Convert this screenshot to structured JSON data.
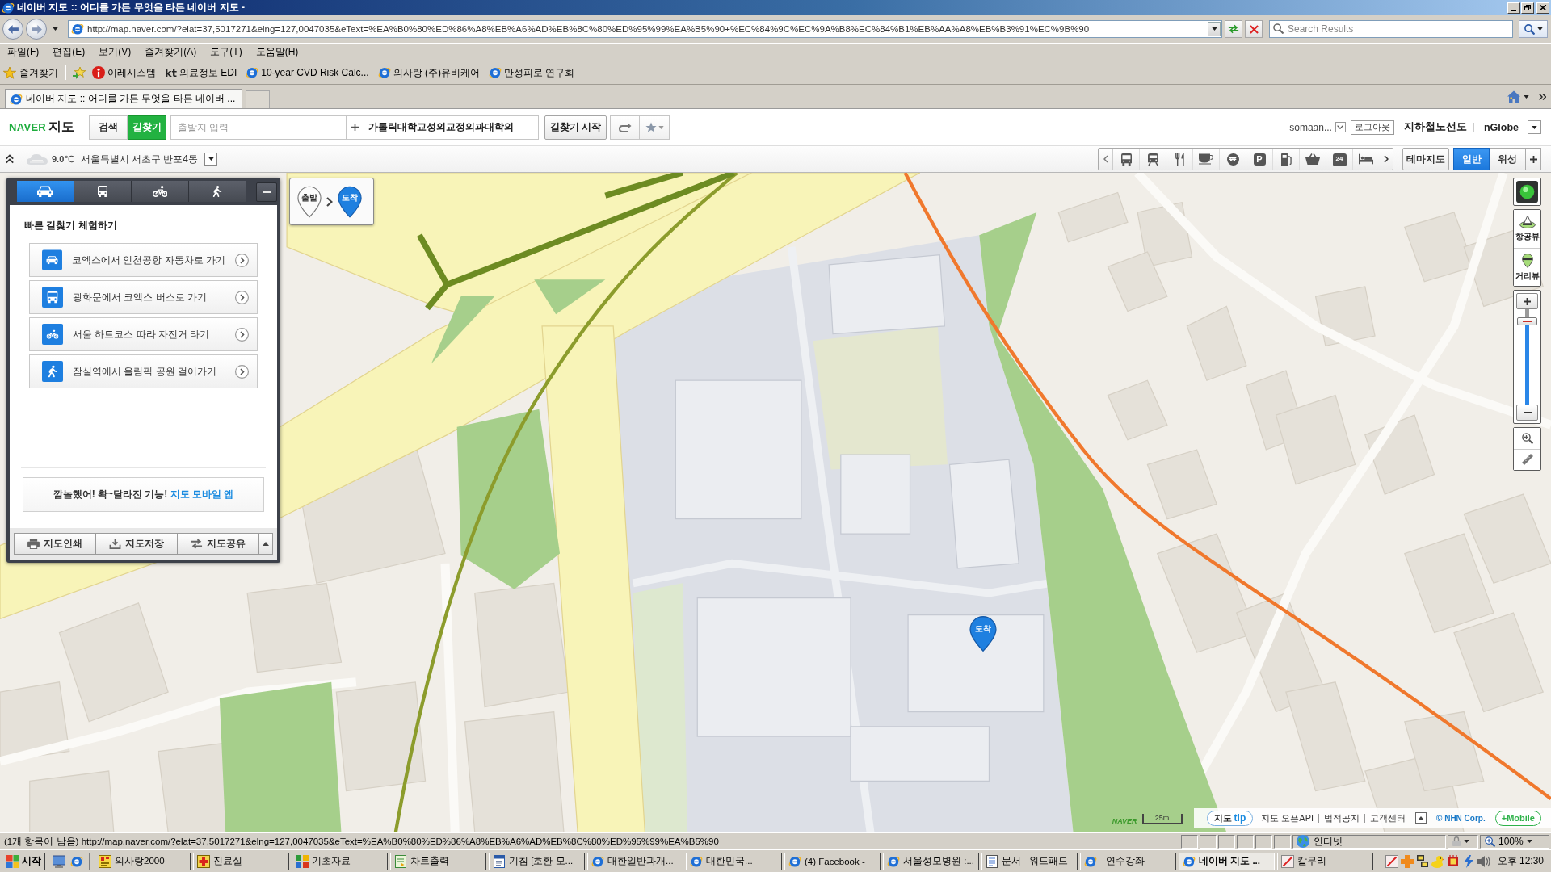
{
  "window": {
    "title": "네이버 지도 :: 어디를 가든 무엇을 타든 네이버 지도 -"
  },
  "address_bar": {
    "url": "http://map.naver.com/?elat=37,5017271&elng=127,0047035&eText=%EA%B0%80%ED%86%A8%EB%A6%AD%EB%8C%80%ED%95%99%EA%B5%90+%EC%84%9C%EC%9A%B8%EC%84%B1%EB%AA%A8%EB%B3%91%EC%9B%90",
    "search_placeholder": "Search Results"
  },
  "menu_bar": [
    "파일(F)",
    "편집(E)",
    "보기(V)",
    "즐겨찾기(A)",
    "도구(T)",
    "도움말(H)"
  ],
  "favorites_bar": {
    "label": "즐겨찾기",
    "items": [
      {
        "kind": "alert",
        "label": "이레시스템"
      },
      {
        "kind": "brand",
        "badge": "kt",
        "label": "의료정보 EDI"
      },
      {
        "kind": "page",
        "label": "10-year CVD Risk Calc..."
      },
      {
        "kind": "page",
        "label": "의사랑 (주)유비케어"
      },
      {
        "kind": "page",
        "label": "만성피로 연구회"
      }
    ]
  },
  "tabs": [
    {
      "label": "네이버 지도 :: 어디를 가든 무엇을 타든 네이버 ...",
      "selected": true
    }
  ],
  "naver_header": {
    "logo": "NAVER",
    "service": "지도",
    "modes": [
      {
        "label": "검색",
        "selected": false
      },
      {
        "label": "길찾기",
        "selected": true
      }
    ],
    "start_field": {
      "placeholder": "출발지 입력"
    },
    "end_field": {
      "value": "가톨릭대학교성의교정의과대학의"
    },
    "start_button": "길찾기 시작",
    "user": "somaan...",
    "logout": "로그아웃",
    "links": [
      "지하철노선도",
      "nGlobe"
    ]
  },
  "location_bar": {
    "temperature": "**9.0**℃",
    "place": "서울특별시 서초구 반포4동"
  },
  "poi_toolbar": [
    {
      "kind": "bus"
    },
    {
      "kind": "subway"
    },
    {
      "kind": "food"
    },
    {
      "kind": "cafe"
    },
    {
      "kind": "bank",
      "glyph": "₩"
    },
    {
      "kind": "parking",
      "glyph": "P"
    },
    {
      "kind": "gas"
    },
    {
      "kind": "shopping"
    },
    {
      "kind": "convenience",
      "glyph": "24"
    },
    {
      "kind": "lodging"
    }
  ],
  "theme_button": "테마지도",
  "map_types": [
    {
      "label": "일반",
      "selected": true
    },
    {
      "label": "위성",
      "selected": false
    }
  ],
  "route_panel": {
    "modes": [
      {
        "kind": "car",
        "selected": true
      },
      {
        "kind": "bus",
        "selected": false
      },
      {
        "kind": "bike",
        "selected": false
      },
      {
        "kind": "walk",
        "selected": false
      }
    ],
    "title": "빠른 길찾기 체험하기",
    "examples": [
      {
        "kind": "car",
        "label": "코엑스에서 인천공항 자동차로 가기"
      },
      {
        "kind": "bus",
        "label": "광화문에서 코엑스 버스로 가기"
      },
      {
        "kind": "bike",
        "label": "서울 하트코스 따라 자전거 타기"
      },
      {
        "kind": "walk",
        "label": "잠실역에서 올림픽 공원 걸어가기"
      }
    ],
    "promo": "깜놀했어! 확~달라진 기능!",
    "promo_link": "지도 모바일 앱",
    "actions": [
      {
        "kind": "print",
        "label": "지도인쇄"
      },
      {
        "kind": "save",
        "label": "지도저장"
      },
      {
        "kind": "share",
        "label": "지도공유"
      }
    ]
  },
  "route_markers": {
    "start": "출발",
    "end": "도착"
  },
  "map": {
    "destination": "도착",
    "logo": "NAVER",
    "scale": "25m"
  },
  "map_controls": {
    "aerial_view": "항공뷰",
    "street_view": "거리뷰",
    "zoom": {
      "level": 0.87
    }
  },
  "map_footer": {
    "tip_prefix": "지도",
    "tip": "tip",
    "links": [
      "지도 오픈API",
      "법적공지",
      "고객센터"
    ],
    "copyright": "© NHN Corp.",
    "mobile": "+Mobile"
  },
  "status_bar": {
    "text": "(1개 항목이 남음) http://map.naver.com/?elat=37,5017271&elng=127,0047035&eText=%EA%B0%80%ED%86%A8%EB%A6%AD%EB%8C%80%ED%95%99%EA%B5%90",
    "zone": "인터넷",
    "zoom": "100%"
  },
  "taskbar": {
    "start": "시작",
    "tasks": [
      {
        "kind": "chart",
        "label": "의사랑2000",
        "selected": false
      },
      {
        "kind": "medical",
        "label": "진료실",
        "selected": false
      },
      {
        "kind": "grid",
        "label": "기초자료",
        "selected": false
      },
      {
        "kind": "print",
        "label": "차트출력",
        "selected": false
      },
      {
        "kind": "word",
        "label": "기침 [호환 모...",
        "selected": false
      },
      {
        "kind": "ie",
        "label": "대한일반과개...",
        "selected": false
      },
      {
        "kind": "ie",
        "label": "대한민국...",
        "selected": false
      },
      {
        "kind": "ie",
        "label": "(4) Facebook -",
        "selected": false
      },
      {
        "kind": "ie",
        "label": "서울성모병원 :...",
        "selected": false
      },
      {
        "kind": "wordpad",
        "label": "문서 - 워드패드",
        "selected": false
      },
      {
        "kind": "ie",
        "label": "- 연수강좌 -",
        "selected": false
      },
      {
        "kind": "ie",
        "label": "네이버 지도 ...",
        "selected": true
      },
      {
        "kind": "knife",
        "label": "칼무리",
        "selected": false
      }
    ],
    "clock": "오후 12:30"
  }
}
